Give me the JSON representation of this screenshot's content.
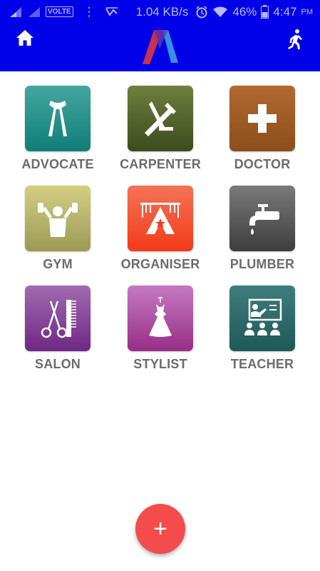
{
  "status_bar": {
    "carrier_badge": "VOLTE",
    "data_speed": "1.04 KB/s",
    "battery_percent": "46%",
    "time": "4:47",
    "time_suffix": "PM"
  },
  "app_bar": {
    "background": "#0000e8",
    "left_icon": "home-icon",
    "center_icon": "app-logo",
    "right_icon": "walking-person-icon"
  },
  "categories": [
    {
      "label": "ADVOCATE",
      "icon": "advocate-bands-icon",
      "color_top": "#45a6a1",
      "color_bottom": "#0f7e77"
    },
    {
      "label": "CARPENTER",
      "icon": "carpenter-tools-icon",
      "color_top": "#6f7f3d",
      "color_bottom": "#3c4b1f"
    },
    {
      "label": "DOCTOR",
      "icon": "medical-cross-icon",
      "color_top": "#b26930",
      "color_bottom": "#8a4e1c"
    },
    {
      "label": "GYM",
      "icon": "weightlifter-icon",
      "color_top": "#d2cf84",
      "color_bottom": "#9b9a55"
    },
    {
      "label": "ORGANISER",
      "icon": "event-stage-icon",
      "color_top": "#f47356",
      "color_bottom": "#f23b1a"
    },
    {
      "label": "PLUMBER",
      "icon": "water-tap-icon",
      "color_top": "#7a7a7a",
      "color_bottom": "#3d3d3d"
    },
    {
      "label": "SALON",
      "icon": "scissors-comb-icon",
      "color_top": "#a16bb0",
      "color_bottom": "#6f2785"
    },
    {
      "label": "STYLIST",
      "icon": "dress-icon",
      "color_top": "#c579c1",
      "color_bottom": "#962e86"
    },
    {
      "label": "TEACHER",
      "icon": "classroom-icon",
      "color_top": "#3f7d7c",
      "color_bottom": "#1f5858"
    }
  ],
  "fab": {
    "label": "+",
    "color": "#f44c4c"
  }
}
